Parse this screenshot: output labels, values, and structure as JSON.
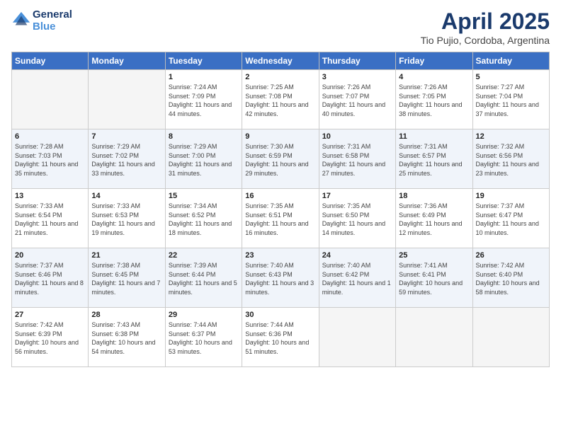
{
  "logo": {
    "line1": "General",
    "line2": "Blue"
  },
  "title": "April 2025",
  "location": "Tio Pujio, Cordoba, Argentina",
  "days_of_week": [
    "Sunday",
    "Monday",
    "Tuesday",
    "Wednesday",
    "Thursday",
    "Friday",
    "Saturday"
  ],
  "weeks": [
    [
      {
        "day": "",
        "empty": true
      },
      {
        "day": "",
        "empty": true
      },
      {
        "day": "1",
        "sunrise": "7:24 AM",
        "sunset": "7:09 PM",
        "daylight": "11 hours and 44 minutes."
      },
      {
        "day": "2",
        "sunrise": "7:25 AM",
        "sunset": "7:08 PM",
        "daylight": "11 hours and 42 minutes."
      },
      {
        "day": "3",
        "sunrise": "7:26 AM",
        "sunset": "7:07 PM",
        "daylight": "11 hours and 40 minutes."
      },
      {
        "day": "4",
        "sunrise": "7:26 AM",
        "sunset": "7:05 PM",
        "daylight": "11 hours and 38 minutes."
      },
      {
        "day": "5",
        "sunrise": "7:27 AM",
        "sunset": "7:04 PM",
        "daylight": "11 hours and 37 minutes."
      }
    ],
    [
      {
        "day": "6",
        "sunrise": "7:28 AM",
        "sunset": "7:03 PM",
        "daylight": "11 hours and 35 minutes."
      },
      {
        "day": "7",
        "sunrise": "7:29 AM",
        "sunset": "7:02 PM",
        "daylight": "11 hours and 33 minutes."
      },
      {
        "day": "8",
        "sunrise": "7:29 AM",
        "sunset": "7:00 PM",
        "daylight": "11 hours and 31 minutes."
      },
      {
        "day": "9",
        "sunrise": "7:30 AM",
        "sunset": "6:59 PM",
        "daylight": "11 hours and 29 minutes."
      },
      {
        "day": "10",
        "sunrise": "7:31 AM",
        "sunset": "6:58 PM",
        "daylight": "11 hours and 27 minutes."
      },
      {
        "day": "11",
        "sunrise": "7:31 AM",
        "sunset": "6:57 PM",
        "daylight": "11 hours and 25 minutes."
      },
      {
        "day": "12",
        "sunrise": "7:32 AM",
        "sunset": "6:56 PM",
        "daylight": "11 hours and 23 minutes."
      }
    ],
    [
      {
        "day": "13",
        "sunrise": "7:33 AM",
        "sunset": "6:54 PM",
        "daylight": "11 hours and 21 minutes."
      },
      {
        "day": "14",
        "sunrise": "7:33 AM",
        "sunset": "6:53 PM",
        "daylight": "11 hours and 19 minutes."
      },
      {
        "day": "15",
        "sunrise": "7:34 AM",
        "sunset": "6:52 PM",
        "daylight": "11 hours and 18 minutes."
      },
      {
        "day": "16",
        "sunrise": "7:35 AM",
        "sunset": "6:51 PM",
        "daylight": "11 hours and 16 minutes."
      },
      {
        "day": "17",
        "sunrise": "7:35 AM",
        "sunset": "6:50 PM",
        "daylight": "11 hours and 14 minutes."
      },
      {
        "day": "18",
        "sunrise": "7:36 AM",
        "sunset": "6:49 PM",
        "daylight": "11 hours and 12 minutes."
      },
      {
        "day": "19",
        "sunrise": "7:37 AM",
        "sunset": "6:47 PM",
        "daylight": "11 hours and 10 minutes."
      }
    ],
    [
      {
        "day": "20",
        "sunrise": "7:37 AM",
        "sunset": "6:46 PM",
        "daylight": "11 hours and 8 minutes."
      },
      {
        "day": "21",
        "sunrise": "7:38 AM",
        "sunset": "6:45 PM",
        "daylight": "11 hours and 7 minutes."
      },
      {
        "day": "22",
        "sunrise": "7:39 AM",
        "sunset": "6:44 PM",
        "daylight": "11 hours and 5 minutes."
      },
      {
        "day": "23",
        "sunrise": "7:40 AM",
        "sunset": "6:43 PM",
        "daylight": "11 hours and 3 minutes."
      },
      {
        "day": "24",
        "sunrise": "7:40 AM",
        "sunset": "6:42 PM",
        "daylight": "11 hours and 1 minute."
      },
      {
        "day": "25",
        "sunrise": "7:41 AM",
        "sunset": "6:41 PM",
        "daylight": "10 hours and 59 minutes."
      },
      {
        "day": "26",
        "sunrise": "7:42 AM",
        "sunset": "6:40 PM",
        "daylight": "10 hours and 58 minutes."
      }
    ],
    [
      {
        "day": "27",
        "sunrise": "7:42 AM",
        "sunset": "6:39 PM",
        "daylight": "10 hours and 56 minutes."
      },
      {
        "day": "28",
        "sunrise": "7:43 AM",
        "sunset": "6:38 PM",
        "daylight": "10 hours and 54 minutes."
      },
      {
        "day": "29",
        "sunrise": "7:44 AM",
        "sunset": "6:37 PM",
        "daylight": "10 hours and 53 minutes."
      },
      {
        "day": "30",
        "sunrise": "7:44 AM",
        "sunset": "6:36 PM",
        "daylight": "10 hours and 51 minutes."
      },
      {
        "day": "",
        "empty": true
      },
      {
        "day": "",
        "empty": true
      },
      {
        "day": "",
        "empty": true
      }
    ]
  ]
}
